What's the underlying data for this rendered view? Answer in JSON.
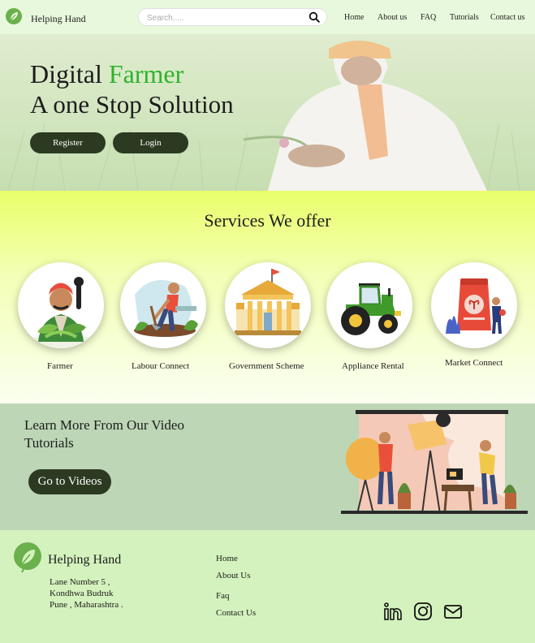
{
  "header": {
    "brand_name": "Helping Hand",
    "search_placeholder": "Search.....",
    "nav": [
      "Home",
      "About us",
      "FAQ",
      "Tutorials",
      "Contact us"
    ]
  },
  "hero": {
    "title_part1": "Digital",
    "title_accent": "Farmer",
    "subtitle": "A one Stop Solution",
    "register_label": "Register",
    "login_label": "Login"
  },
  "services": {
    "title": "Services We offer",
    "items": [
      {
        "label": "Farmer",
        "icon": "farmer-icon"
      },
      {
        "label": "Labour Connect",
        "icon": "labourer-icon"
      },
      {
        "label": "Government Scheme",
        "icon": "government-building-icon"
      },
      {
        "label": "Appliance Rental",
        "icon": "tractor-icon"
      },
      {
        "label": "Market Connect",
        "icon": "seed-bag-icon"
      }
    ]
  },
  "tutorials": {
    "title": "Learn More From Our Video Tutorials",
    "button_label": "Go to Videos"
  },
  "footer": {
    "brand_name": "Helping Hand",
    "address": [
      "Lane Number 5 ,",
      "Kondhwa Budruk",
      "Pune , Maharashtra ."
    ],
    "links": [
      "Home",
      "About Us",
      "Faq",
      "Contact Us"
    ],
    "social_icons": [
      "linkedin-icon",
      "instagram-icon",
      "mail-icon"
    ]
  },
  "colors": {
    "accent_green": "#2fb32a",
    "button_dark": "#2c3a22",
    "header_bg": "#e8f8dc",
    "tutorials_bg": "#bcd6b6",
    "footer_bg": "#d4f2bd"
  }
}
